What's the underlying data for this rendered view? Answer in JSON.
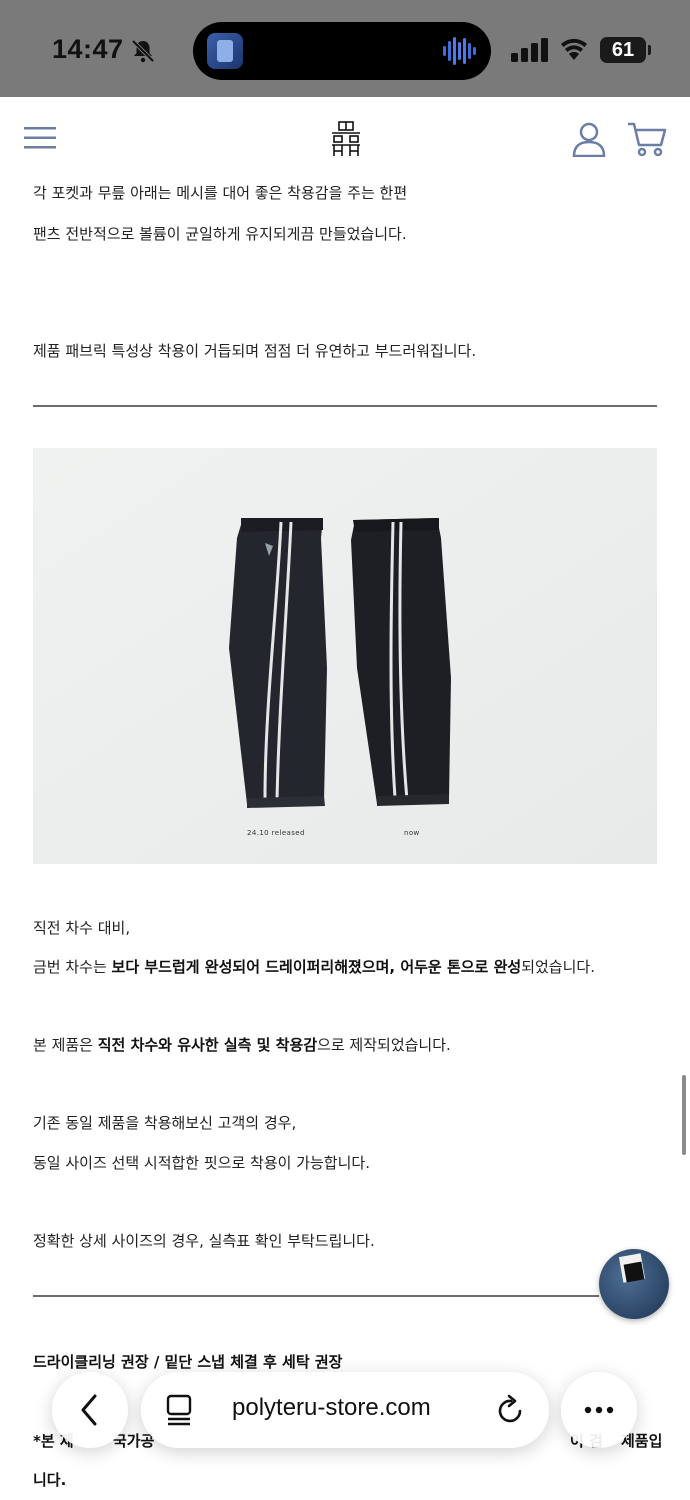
{
  "status_bar": {
    "time": "14:47",
    "battery": "61"
  },
  "browser": {
    "url": "polyteru-store.com"
  },
  "content": {
    "para1_line1": "각 포켓과 무릎 아래는 메시를 대어 좋은 착용감을 주는 한편",
    "para1_line2": "팬츠 전반적으로 볼륨이 균일하게 유지되게끔 만들었습니다.",
    "para2": "제품 패브릭 특성상 착용이 거듭되며 점점 더 유연하고 부드러워집니다.",
    "image_caption_left": "24.10 released",
    "image_caption_right": "now",
    "compare_line1": "직전 차수 대비,",
    "compare_line2_pre": "금번 차수는 ",
    "compare_line2_bold": "보다 부드럽게 완성되어 드레이퍼리해졌으며, 어두운 톤으로 완성",
    "compare_line2_post": "되었습니다.",
    "fit_pre": "본 제품은 ",
    "fit_bold": "직전 차수와 유사한 실측 및 착용감",
    "fit_post": "으로 제작되었습니다.",
    "existing_line1": "기존 동일 제품을 착용해보신 고객의 경우,",
    "existing_line2": "동일 사이즈 선택 시적합한 핏으로 착용이 가능합니다.",
    "size_note": "정확한 상세 사이즈의 경우, 실측표 확인 부탁드립니다.",
    "care_heading": "드라이클리닝 권장 / 밑단 스냅 체결 후 세탁 권장",
    "notice_line1_start": "*본 제",
    "notice_line1_mid": "국가공",
    "notice_line1_end": "이 검",
    "notice_line1_tail": "제품입",
    "notice_line2": "니다."
  }
}
